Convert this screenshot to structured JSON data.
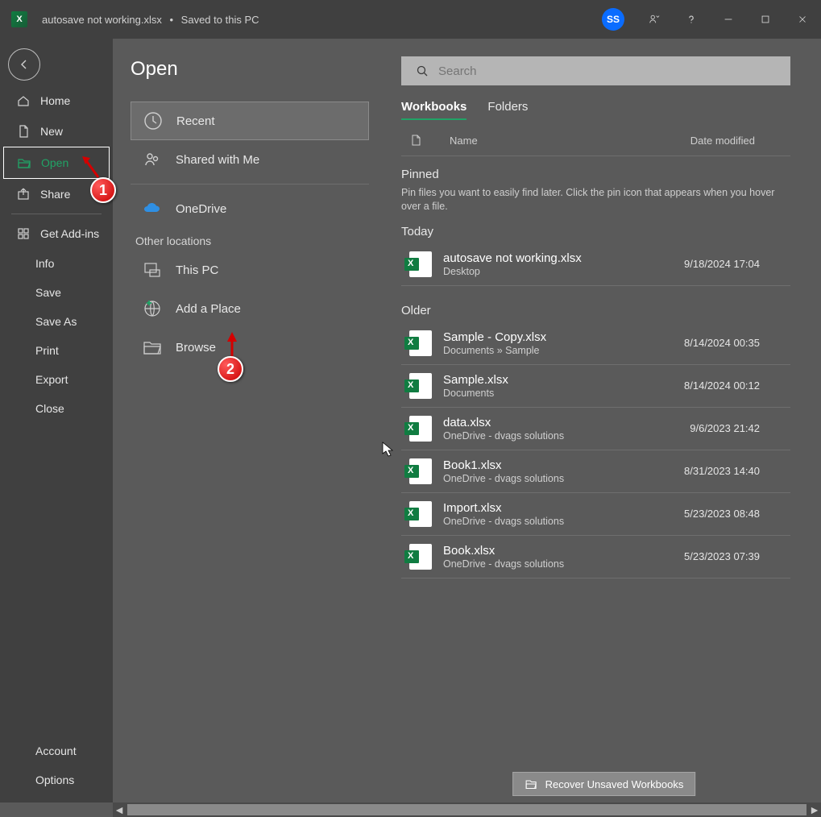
{
  "titlebar": {
    "filename": "autosave not working.xlsx",
    "status": "Saved to this PC",
    "user_initials": "SS"
  },
  "page_title": "Open",
  "sidebar": {
    "items": [
      {
        "label": "Home"
      },
      {
        "label": "New"
      },
      {
        "label": "Open"
      },
      {
        "label": "Share"
      },
      {
        "label": "Get Add-ins"
      },
      {
        "label": "Info"
      },
      {
        "label": "Save"
      },
      {
        "label": "Save As"
      },
      {
        "label": "Print"
      },
      {
        "label": "Export"
      },
      {
        "label": "Close"
      }
    ],
    "bottom": [
      {
        "label": "Account"
      },
      {
        "label": "Options"
      }
    ]
  },
  "locations": {
    "items": [
      {
        "label": "Recent"
      },
      {
        "label": "Shared with Me"
      },
      {
        "label": "OneDrive"
      }
    ],
    "other_heading": "Other locations",
    "other": [
      {
        "label": "This PC"
      },
      {
        "label": "Add a Place"
      },
      {
        "label": "Browse"
      }
    ]
  },
  "search": {
    "placeholder": "Search"
  },
  "tabs": [
    {
      "label": "Workbooks"
    },
    {
      "label": "Folders"
    }
  ],
  "columns": {
    "name": "Name",
    "date": "Date modified"
  },
  "sections": {
    "pinned_title": "Pinned",
    "pinned_text": "Pin files you want to easily find later. Click the pin icon that appears when you hover over a file.",
    "today_title": "Today",
    "older_title": "Older"
  },
  "files_today": [
    {
      "name": "autosave not working.xlsx",
      "path": "Desktop",
      "date": "9/18/2024 17:04"
    }
  ],
  "files_older": [
    {
      "name": "Sample - Copy.xlsx",
      "path": "Documents » Sample",
      "date": "8/14/2024 00:35"
    },
    {
      "name": "Sample.xlsx",
      "path": "Documents",
      "date": "8/14/2024 00:12"
    },
    {
      "name": "data.xlsx",
      "path": "OneDrive - dvags solutions",
      "date": "9/6/2023 21:42"
    },
    {
      "name": "Book1.xlsx",
      "path": "OneDrive - dvags solutions",
      "date": "8/31/2023 14:40"
    },
    {
      "name": "Import.xlsx",
      "path": "OneDrive - dvags solutions",
      "date": "5/23/2023 08:48"
    },
    {
      "name": "Book.xlsx",
      "path": "OneDrive - dvags solutions",
      "date": "5/23/2023 07:39"
    }
  ],
  "recover_label": "Recover Unsaved Workbooks",
  "annotations": {
    "badge1": "1",
    "badge2": "2"
  }
}
